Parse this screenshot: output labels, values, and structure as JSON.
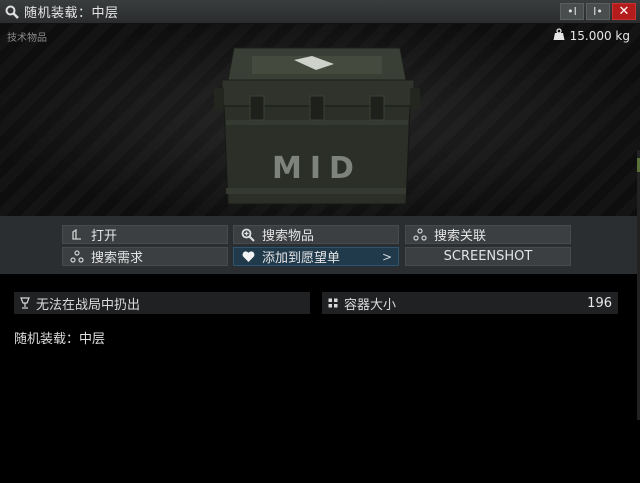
{
  "window": {
    "title": "随机装载：中层",
    "buttons": {
      "pin": "•I",
      "unpin": "I•",
      "close": "✕"
    }
  },
  "preview": {
    "category": "技术物品",
    "weight": "15.000 kg",
    "crate_label": "MID"
  },
  "actions": [
    {
      "label": "打开",
      "icon": "open-icon"
    },
    {
      "label": "搜索物品",
      "icon": "search-icon"
    },
    {
      "label": "搜索关联",
      "icon": "link-icon"
    },
    {
      "label": "搜索需求",
      "icon": "link-icon"
    },
    {
      "label": "添加到愿望单",
      "icon": "heart-icon",
      "chevron": ">"
    },
    {
      "label": "SCREENSHOT",
      "icon": ""
    }
  ],
  "info": {
    "raid_flag": {
      "label": "无法在战局中扔出",
      "icon": "cup-icon"
    },
    "container": {
      "label": "容器大小",
      "value": "196",
      "icon": "grid-icon"
    }
  },
  "description": "随机装载：中层",
  "colors": {
    "accent": "#203a4c",
    "close": "#b41b1b"
  }
}
